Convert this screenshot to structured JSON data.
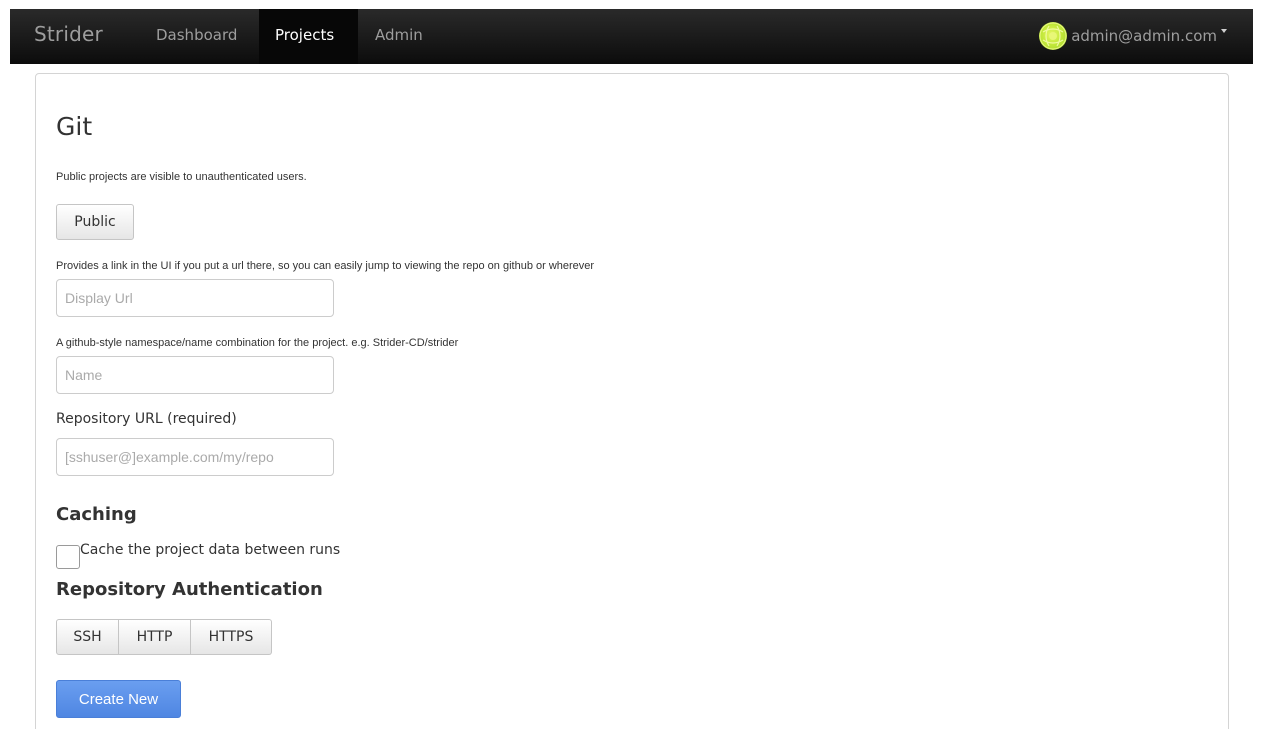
{
  "navbar": {
    "brand": "Strider",
    "items": [
      {
        "label": "Dashboard",
        "active": false
      },
      {
        "label": "Projects",
        "active": true
      },
      {
        "label": "Admin",
        "active": false
      }
    ],
    "user_email": "admin@admin.com"
  },
  "form": {
    "title": "Git",
    "public_help": "Public projects are visible to unauthenticated users.",
    "public_button": "Public",
    "display_url_help": "Provides a link in the UI if you put a url there, so you can easily jump to viewing the repo on github or wherever",
    "display_url_placeholder": "Display Url",
    "display_url_value": "",
    "name_help": "A github-style namespace/name combination for the project. e.g. Strider-CD/strider",
    "name_placeholder": "Name",
    "name_value": "",
    "repo_url_label": "Repository URL (required)",
    "repo_url_placeholder": "[sshuser@]example.com/my/repo",
    "repo_url_value": "",
    "caching_title": "Caching",
    "cache_checkbox_label": "Cache the project data between runs",
    "cache_checked": false,
    "auth_title": "Repository Authentication",
    "auth_options": [
      "SSH",
      "HTTP",
      "HTTPS"
    ],
    "submit_button": "Create New"
  },
  "colors": {
    "navbar_bg": "#111111",
    "nav_text": "#9d9d9d",
    "nav_active_text": "#ffffff",
    "primary_button": "#5b8fe8",
    "avatar": "#c2e83a"
  }
}
